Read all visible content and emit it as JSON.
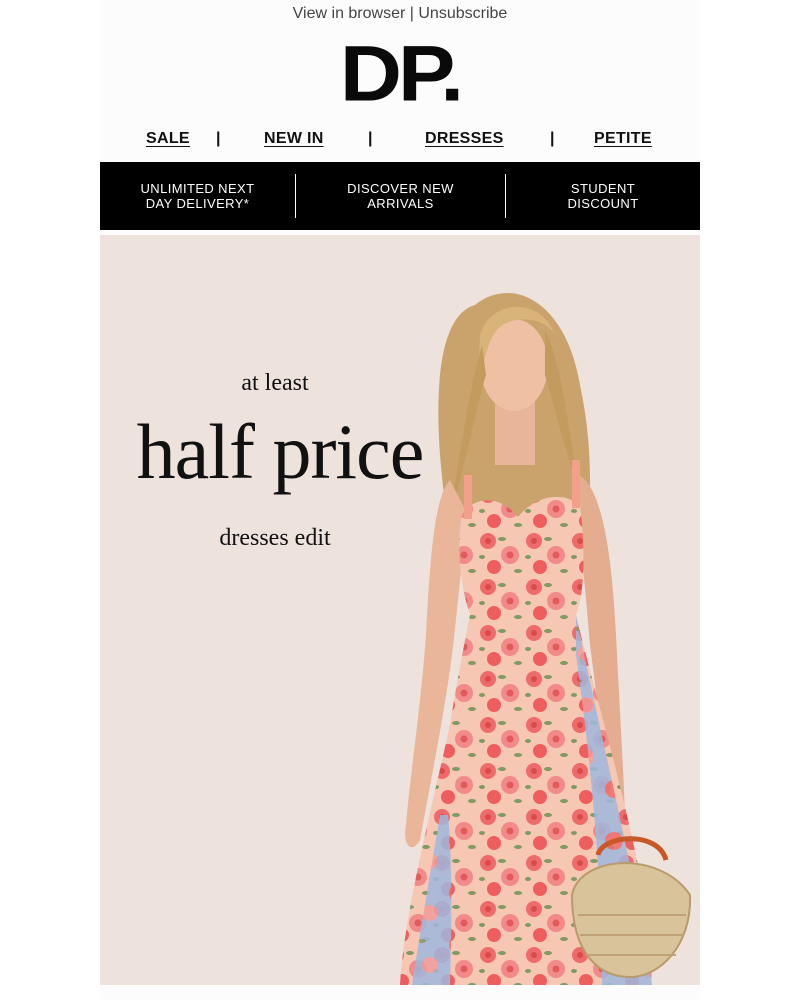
{
  "header": {
    "view_in_browser": "View in browser",
    "separator": "|",
    "unsubscribe": "Unsubscribe",
    "logo": "DP."
  },
  "nav": {
    "items": [
      "SALE",
      "NEW IN",
      "DRESSES",
      "PETITE"
    ],
    "separator": "|"
  },
  "promo_bar": {
    "items": [
      {
        "line1": "UNLIMITED NEXT",
        "line2": "DAY DELIVERY*"
      },
      {
        "line1": "DISCOVER NEW",
        "line2": "ARRIVALS"
      },
      {
        "line1": "STUDENT",
        "line2": "DISCOUNT"
      }
    ]
  },
  "hero": {
    "line1": "at least",
    "line2": "half price",
    "line3": "dresses edit",
    "image_alt": "model wearing floral dress"
  },
  "colors": {
    "hero_bg": "#ede3dc",
    "promo_bg": "#000000",
    "text": "#111111"
  }
}
